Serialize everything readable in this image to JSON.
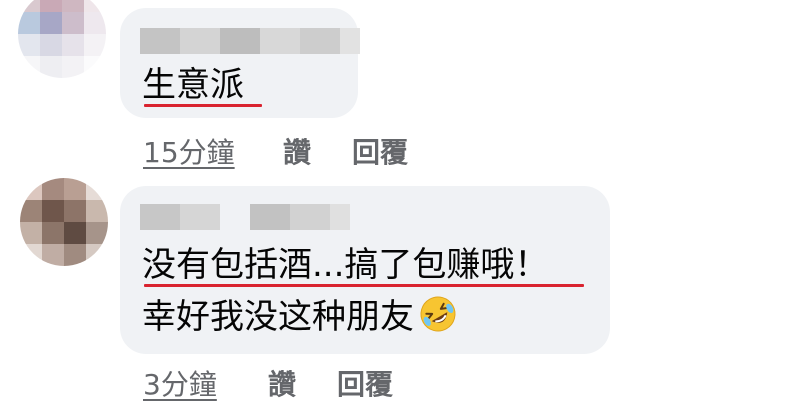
{
  "comments": [
    {
      "text": "生意派",
      "time": "15分鐘",
      "like_label": "讚",
      "reply_label": "回覆"
    },
    {
      "line1": "没有包括酒...搞了包赚哦！",
      "line2": "幸好我没这种朋友",
      "emoji": "rolling-on-floor-laughing-emoji",
      "time": "3分鐘",
      "like_label": "讚",
      "reply_label": "回覆"
    }
  ],
  "colors": {
    "bubble": "#f0f2f5",
    "underline": "#d9232f",
    "meta_text": "#65676b"
  }
}
